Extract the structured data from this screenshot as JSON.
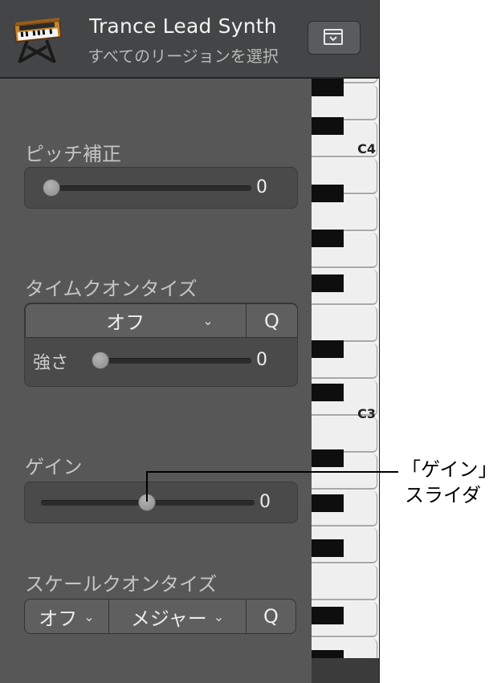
{
  "header": {
    "track_name": "Trance Lead Synth",
    "subtitle": "すべてのリージョンを選択",
    "instrument_icon": "synth-keyboard-icon",
    "disclosure_icon": "window-disclosure-icon"
  },
  "pitch_correction": {
    "label": "ピッチ補正",
    "value": "0",
    "level_fraction": 0.0
  },
  "time_quantize": {
    "label": "タイムクオンタイズ",
    "selected": "オフ",
    "q_button": "Q",
    "strength_label": "強さ",
    "strength_value": "0",
    "level_fraction": 0.0
  },
  "gain": {
    "label": "ゲイン",
    "value": "0",
    "level_fraction": 0.5
  },
  "scale_quantize": {
    "label": "スケールクオンタイズ",
    "root_selected": "オフ",
    "scale_selected": "メジャー",
    "q_button": "Q"
  },
  "keyboard": {
    "octave_labels": [
      "C4",
      "C3"
    ]
  },
  "callout": {
    "line1": "「ゲイン」",
    "line2": "スライダ"
  },
  "colors": {
    "panel_bg": "#575757",
    "header_bg": "#444546",
    "accent_text": "#ededed"
  }
}
